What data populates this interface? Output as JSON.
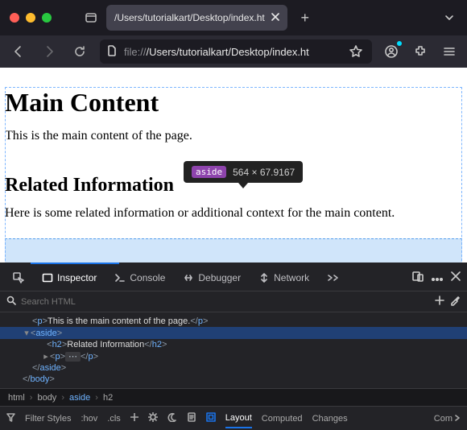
{
  "titlebar": {
    "tab_title": "/Users/tutorialkart/Desktop/index.ht"
  },
  "urlbar": {
    "scheme": "file://",
    "path": "/Users/tutorialkart/Desktop/index.ht"
  },
  "page": {
    "h1": "Main Content",
    "p1": "This is the main content of the page.",
    "aside_h2": "Related Information",
    "aside_p": "Here is some related information or additional context for the main content.",
    "tooltip_tag": "aside",
    "tooltip_dims": "564 × 67.9167"
  },
  "devtools": {
    "tabs": {
      "inspector": "Inspector",
      "console": "Console",
      "debugger": "Debugger",
      "network": "Network"
    },
    "search_placeholder": "Search HTML",
    "code": {
      "l1_text": "This is the main content of the page.",
      "l2_tag": "aside",
      "l3_tag": "h2",
      "l3_text": "Related Information",
      "l4_tag": "p",
      "l5_close": "aside",
      "l6_close": "body"
    },
    "breadcrumb": [
      "html",
      "body",
      "aside",
      "h2"
    ],
    "bottom": {
      "filter": "Filter Styles",
      "hov": ":hov",
      "cls": ".cls",
      "layout": "Layout",
      "computed": "Computed",
      "changes": "Changes",
      "compat": "Com"
    }
  }
}
